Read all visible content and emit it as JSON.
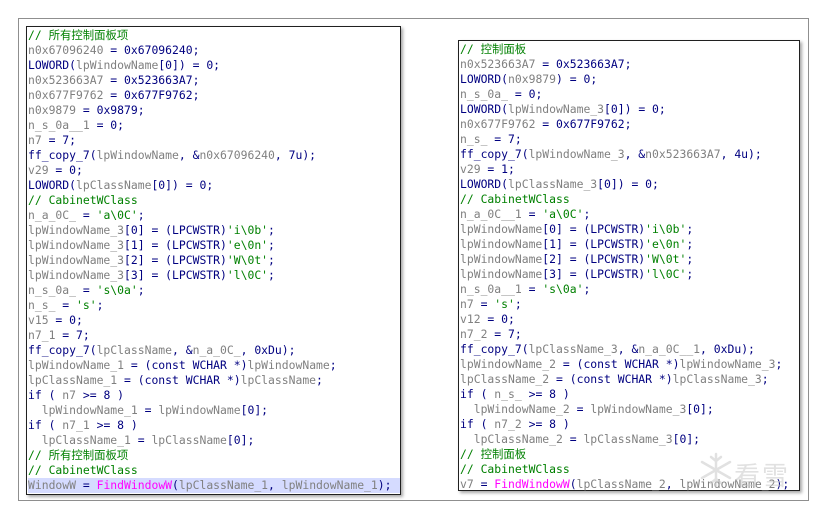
{
  "left_panel": {
    "lines": [
      [
        {
          "t": "// 所有控制面板项",
          "c": "c"
        }
      ],
      [
        {
          "t": "n0x67096240",
          "c": "v"
        },
        {
          "t": " = 0x67096240;",
          "c": "k"
        }
      ],
      [
        {
          "t": "LOWORD(",
          "c": "k"
        },
        {
          "t": "lpWindowName",
          "c": "v"
        },
        {
          "t": "[0]) = 0;",
          "c": "k"
        }
      ],
      [
        {
          "t": "n0x523663A7",
          "c": "v"
        },
        {
          "t": " = 0x523663A7;",
          "c": "k"
        }
      ],
      [
        {
          "t": "n0x677F9762",
          "c": "v"
        },
        {
          "t": " = 0x677F9762;",
          "c": "k"
        }
      ],
      [
        {
          "t": "n0x9879",
          "c": "v"
        },
        {
          "t": " = 0x9879;",
          "c": "k"
        }
      ],
      [
        {
          "t": "n_s_0a__1",
          "c": "v"
        },
        {
          "t": " = 0;",
          "c": "k"
        }
      ],
      [
        {
          "t": "n7",
          "c": "v"
        },
        {
          "t": " = 7;",
          "c": "k"
        }
      ],
      [
        {
          "t": "ff_copy_7(",
          "c": "k"
        },
        {
          "t": "lpWindowName",
          "c": "v"
        },
        {
          "t": ", &",
          "c": "k"
        },
        {
          "t": "n0x67096240",
          "c": "v"
        },
        {
          "t": ", 7u);",
          "c": "k"
        }
      ],
      [
        {
          "t": "v29",
          "c": "v"
        },
        {
          "t": " = 0;",
          "c": "k"
        }
      ],
      [
        {
          "t": "LOWORD(",
          "c": "k"
        },
        {
          "t": "lpClassName",
          "c": "v"
        },
        {
          "t": "[0]) = 0;",
          "c": "k"
        }
      ],
      [
        {
          "t": "// CabinetWClass",
          "c": "c"
        }
      ],
      [
        {
          "t": "n_a_0C_",
          "c": "v"
        },
        {
          "t": " = ",
          "c": "k"
        },
        {
          "t": "'a\\0C'",
          "c": "s"
        },
        {
          "t": ";",
          "c": "k"
        }
      ],
      [
        {
          "t": "lpWindowName_3",
          "c": "v"
        },
        {
          "t": "[0] = (LPCWSTR)",
          "c": "k"
        },
        {
          "t": "'i\\0b'",
          "c": "s"
        },
        {
          "t": ";",
          "c": "k"
        }
      ],
      [
        {
          "t": "lpWindowName_3",
          "c": "v"
        },
        {
          "t": "[1] = (LPCWSTR)",
          "c": "k"
        },
        {
          "t": "'e\\0n'",
          "c": "s"
        },
        {
          "t": ";",
          "c": "k"
        }
      ],
      [
        {
          "t": "lpWindowName_3",
          "c": "v"
        },
        {
          "t": "[2] = (LPCWSTR)",
          "c": "k"
        },
        {
          "t": "'W\\0t'",
          "c": "s"
        },
        {
          "t": ";",
          "c": "k"
        }
      ],
      [
        {
          "t": "lpWindowName_3",
          "c": "v"
        },
        {
          "t": "[3] = (LPCWSTR)",
          "c": "k"
        },
        {
          "t": "'l\\0C'",
          "c": "s"
        },
        {
          "t": ";",
          "c": "k"
        }
      ],
      [
        {
          "t": "n_s_0a_",
          "c": "v"
        },
        {
          "t": " = ",
          "c": "k"
        },
        {
          "t": "'s\\0a'",
          "c": "s"
        },
        {
          "t": ";",
          "c": "k"
        }
      ],
      [
        {
          "t": "n_s_",
          "c": "v"
        },
        {
          "t": " = ",
          "c": "k"
        },
        {
          "t": "'s'",
          "c": "s"
        },
        {
          "t": ";",
          "c": "k"
        }
      ],
      [
        {
          "t": "v15",
          "c": "v"
        },
        {
          "t": " = 0;",
          "c": "k"
        }
      ],
      [
        {
          "t": "n7_1",
          "c": "v"
        },
        {
          "t": " = 7;",
          "c": "k"
        }
      ],
      [
        {
          "t": "ff_copy_7(",
          "c": "k"
        },
        {
          "t": "lpClassName",
          "c": "v"
        },
        {
          "t": ", &",
          "c": "k"
        },
        {
          "t": "n_a_0C_",
          "c": "v"
        },
        {
          "t": ", 0xDu);",
          "c": "k"
        }
      ],
      [
        {
          "t": "lpWindowName_1",
          "c": "v"
        },
        {
          "t": " = (const WCHAR *)",
          "c": "k"
        },
        {
          "t": "lpWindowName",
          "c": "v"
        },
        {
          "t": ";",
          "c": "k"
        }
      ],
      [
        {
          "t": "lpClassName_1",
          "c": "v"
        },
        {
          "t": " = (const WCHAR *)",
          "c": "k"
        },
        {
          "t": "lpClassName",
          "c": "v"
        },
        {
          "t": ";",
          "c": "k"
        }
      ],
      [
        {
          "t": "if ( ",
          "c": "k"
        },
        {
          "t": "n7",
          "c": "v"
        },
        {
          "t": " >= 8 )",
          "c": "k"
        }
      ],
      [
        {
          "t": "  ",
          "c": "k"
        },
        {
          "t": "lpWindowName_1",
          "c": "v"
        },
        {
          "t": " = ",
          "c": "k"
        },
        {
          "t": "lpWindowName",
          "c": "v"
        },
        {
          "t": "[0];",
          "c": "k"
        }
      ],
      [
        {
          "t": "if ( ",
          "c": "k"
        },
        {
          "t": "n7_1",
          "c": "v"
        },
        {
          "t": " >= 8 )",
          "c": "k"
        }
      ],
      [
        {
          "t": "  ",
          "c": "k"
        },
        {
          "t": "lpClassName_1",
          "c": "v"
        },
        {
          "t": " = ",
          "c": "k"
        },
        {
          "t": "lpClassName",
          "c": "v"
        },
        {
          "t": "[0];",
          "c": "k"
        }
      ],
      [
        {
          "t": "// 所有控制面板项",
          "c": "c"
        }
      ],
      [
        {
          "t": "// CabinetWClass",
          "c": "c"
        }
      ],
      [
        {
          "t": "WindowW",
          "c": "v"
        },
        {
          "t": " = ",
          "c": "k"
        },
        {
          "t": "FindWindowW",
          "c": "f"
        },
        {
          "t": "(",
          "c": "k"
        },
        {
          "t": "lpClassName_1",
          "c": "v"
        },
        {
          "t": ", ",
          "c": "k"
        },
        {
          "t": "lpWindowName_1",
          "c": "v"
        },
        {
          "t": ");",
          "c": "k"
        }
      ]
    ],
    "highlight_last": true
  },
  "right_panel": {
    "lines": [
      [
        {
          "t": "// 控制面板",
          "c": "c"
        }
      ],
      [
        {
          "t": "n0x523663A7",
          "c": "v"
        },
        {
          "t": " = 0x523663A7;",
          "c": "k"
        }
      ],
      [
        {
          "t": "LOWORD(",
          "c": "k"
        },
        {
          "t": "n0x9879",
          "c": "v"
        },
        {
          "t": ") = 0;",
          "c": "k"
        }
      ],
      [
        {
          "t": "n_s_0a_",
          "c": "v"
        },
        {
          "t": " = 0;",
          "c": "k"
        }
      ],
      [
        {
          "t": "LOWORD(",
          "c": "k"
        },
        {
          "t": "lpWindowName_3",
          "c": "v"
        },
        {
          "t": "[0]) = 0;",
          "c": "k"
        }
      ],
      [
        {
          "t": "n0x677F9762",
          "c": "v"
        },
        {
          "t": " = 0x677F9762;",
          "c": "k"
        }
      ],
      [
        {
          "t": "n_s_",
          "c": "v"
        },
        {
          "t": " = 7;",
          "c": "k"
        }
      ],
      [
        {
          "t": "ff_copy_7(",
          "c": "k"
        },
        {
          "t": "lpWindowName_3",
          "c": "v"
        },
        {
          "t": ", &",
          "c": "k"
        },
        {
          "t": "n0x523663A7",
          "c": "v"
        },
        {
          "t": ", 4u);",
          "c": "k"
        }
      ],
      [
        {
          "t": "v29",
          "c": "v"
        },
        {
          "t": " = 1;",
          "c": "k"
        }
      ],
      [
        {
          "t": "LOWORD(",
          "c": "k"
        },
        {
          "t": "lpClassName_3",
          "c": "v"
        },
        {
          "t": "[0]) = 0;",
          "c": "k"
        }
      ],
      [
        {
          "t": "// CabinetWClass",
          "c": "c"
        }
      ],
      [
        {
          "t": "n_a_0C__1",
          "c": "v"
        },
        {
          "t": " = ",
          "c": "k"
        },
        {
          "t": "'a\\0C'",
          "c": "s"
        },
        {
          "t": ";",
          "c": "k"
        }
      ],
      [
        {
          "t": "lpWindowName",
          "c": "v"
        },
        {
          "t": "[0] = (LPCWSTR)",
          "c": "k"
        },
        {
          "t": "'i\\0b'",
          "c": "s"
        },
        {
          "t": ";",
          "c": "k"
        }
      ],
      [
        {
          "t": "lpWindowName",
          "c": "v"
        },
        {
          "t": "[1] = (LPCWSTR)",
          "c": "k"
        },
        {
          "t": "'e\\0n'",
          "c": "s"
        },
        {
          "t": ";",
          "c": "k"
        }
      ],
      [
        {
          "t": "lpWindowName",
          "c": "v"
        },
        {
          "t": "[2] = (LPCWSTR)",
          "c": "k"
        },
        {
          "t": "'W\\0t'",
          "c": "s"
        },
        {
          "t": ";",
          "c": "k"
        }
      ],
      [
        {
          "t": "lpWindowName",
          "c": "v"
        },
        {
          "t": "[3] = (LPCWSTR)",
          "c": "k"
        },
        {
          "t": "'l\\0C'",
          "c": "s"
        },
        {
          "t": ";",
          "c": "k"
        }
      ],
      [
        {
          "t": "n_s_0a__1",
          "c": "v"
        },
        {
          "t": " = ",
          "c": "k"
        },
        {
          "t": "'s\\0a'",
          "c": "s"
        },
        {
          "t": ";",
          "c": "k"
        }
      ],
      [
        {
          "t": "n7",
          "c": "v"
        },
        {
          "t": " = ",
          "c": "k"
        },
        {
          "t": "'s'",
          "c": "s"
        },
        {
          "t": ";",
          "c": "k"
        }
      ],
      [
        {
          "t": "v12",
          "c": "v"
        },
        {
          "t": " = 0;",
          "c": "k"
        }
      ],
      [
        {
          "t": "n7_2",
          "c": "v"
        },
        {
          "t": " = 7;",
          "c": "k"
        }
      ],
      [
        {
          "t": "ff_copy_7(",
          "c": "k"
        },
        {
          "t": "lpClassName_3",
          "c": "v"
        },
        {
          "t": ", &",
          "c": "k"
        },
        {
          "t": "n_a_0C__1",
          "c": "v"
        },
        {
          "t": ", 0xDu);",
          "c": "k"
        }
      ],
      [
        {
          "t": "lpWindowName_2",
          "c": "v"
        },
        {
          "t": " = (const WCHAR *)",
          "c": "k"
        },
        {
          "t": "lpWindowName_3",
          "c": "v"
        },
        {
          "t": ";",
          "c": "k"
        }
      ],
      [
        {
          "t": "lpClassName_2",
          "c": "v"
        },
        {
          "t": " = (const WCHAR *)",
          "c": "k"
        },
        {
          "t": "lpClassName_3",
          "c": "v"
        },
        {
          "t": ";",
          "c": "k"
        }
      ],
      [
        {
          "t": "if ( ",
          "c": "k"
        },
        {
          "t": "n_s_",
          "c": "v"
        },
        {
          "t": " >= 8 )",
          "c": "k"
        }
      ],
      [
        {
          "t": "  ",
          "c": "k"
        },
        {
          "t": "lpWindowName_2",
          "c": "v"
        },
        {
          "t": " = ",
          "c": "k"
        },
        {
          "t": "lpWindowName_3",
          "c": "v"
        },
        {
          "t": "[0];",
          "c": "k"
        }
      ],
      [
        {
          "t": "if ( ",
          "c": "k"
        },
        {
          "t": "n7_2",
          "c": "v"
        },
        {
          "t": " >= 8 )",
          "c": "k"
        }
      ],
      [
        {
          "t": "  ",
          "c": "k"
        },
        {
          "t": "lpClassName_2",
          "c": "v"
        },
        {
          "t": " = ",
          "c": "k"
        },
        {
          "t": "lpClassName_3",
          "c": "v"
        },
        {
          "t": "[0];",
          "c": "k"
        }
      ],
      [
        {
          "t": "// 控制面板",
          "c": "c"
        }
      ],
      [
        {
          "t": "// CabinetWClass",
          "c": "c"
        }
      ],
      [
        {
          "t": "v7",
          "c": "v"
        },
        {
          "t": " = ",
          "c": "k"
        },
        {
          "t": "FindWindowW",
          "c": "f"
        },
        {
          "t": "(",
          "c": "k"
        },
        {
          "t": "lpClassName_2",
          "c": "v"
        },
        {
          "t": ", ",
          "c": "k"
        },
        {
          "t": "lpWindowName_2",
          "c": "v"
        },
        {
          "t": ");",
          "c": "k"
        }
      ]
    ],
    "highlight_last": false
  },
  "watermark": {
    "icon": "snowflake-icon",
    "text": "看雪"
  }
}
